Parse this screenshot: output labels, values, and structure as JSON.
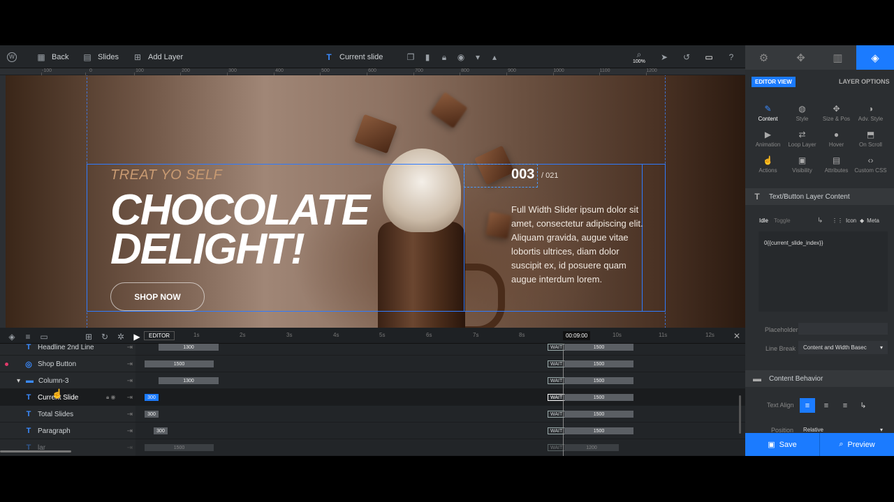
{
  "topbar": {
    "back": "Back",
    "slides": "Slides",
    "add_layer": "Add Layer",
    "current": "Current slide",
    "zoom": "100%"
  },
  "ruler": [
    "-100",
    "0",
    "100",
    "200",
    "300",
    "400",
    "500",
    "600",
    "700",
    "800",
    "900",
    "1000",
    "1100",
    "1200"
  ],
  "slide": {
    "treat": "TREAT YO SELF",
    "line1": "CHOCOLATE",
    "line2": "DELIGHT!",
    "button": "SHOP NOW",
    "current": "003",
    "total": "/ 021",
    "paragraph": "Full Width Slider ipsum dolor sit amet, consectetur adipiscing elit. Aliquam gravida, augue vitae lobortis ultrices, diam dolor suscipit ex, id posuere quam augue interdum lorem."
  },
  "timeline": {
    "editor": "EDITOR",
    "time": "00:09:00",
    "ticks": [
      "1s",
      "2s",
      "3s",
      "4s",
      "5s",
      "6s",
      "7s",
      "8s",
      "9s",
      "10s",
      "11s",
      "12s"
    ],
    "rows": [
      {
        "name": "Headline 2nd Line",
        "bar": "1300",
        "wait": "WAIT",
        "end": "1500"
      },
      {
        "name": "Shop Button",
        "bar": "1500",
        "wait": "WAIT",
        "end": "1500"
      },
      {
        "name": "Column-3",
        "bar": "1300",
        "wait": "WAIT",
        "end": "1500"
      },
      {
        "name": "Current Slide",
        "bar": "300",
        "wait": "WAIT",
        "end": "1500"
      },
      {
        "name": "Total Slides",
        "bar": "300",
        "wait": "WAIT",
        "end": "1500"
      },
      {
        "name": "Paragraph",
        "bar": "300",
        "wait": "WAIT",
        "end": "1500"
      },
      {
        "name": "lar",
        "bar": "1500",
        "wait": "WAIT",
        "end": "1200"
      }
    ]
  },
  "panel": {
    "editor_view": "EDITOR VIEW",
    "layer_options": "LAYER OPTIONS",
    "options": [
      "Content",
      "Style",
      "Size & Pos",
      "Adv. Style",
      "Animation",
      "Loop Layer",
      "Hover",
      "On Scroll",
      "Actions",
      "Visibility",
      "Attributes",
      "Custom CSS"
    ],
    "section1": "Text/Button Layer Content",
    "idle": "Idle",
    "toggle": "Toggle",
    "icon": "Icon",
    "meta": "Meta",
    "content": "0{{current_slide_index}}",
    "placeholder": "Placeholder",
    "line_break": "Line Break",
    "line_break_val": "Content and Width Basec",
    "section2": "Content Behavior",
    "text_align": "Text Align",
    "position": "Position",
    "position_val": "Relative",
    "save": "Save",
    "preview": "Preview"
  }
}
